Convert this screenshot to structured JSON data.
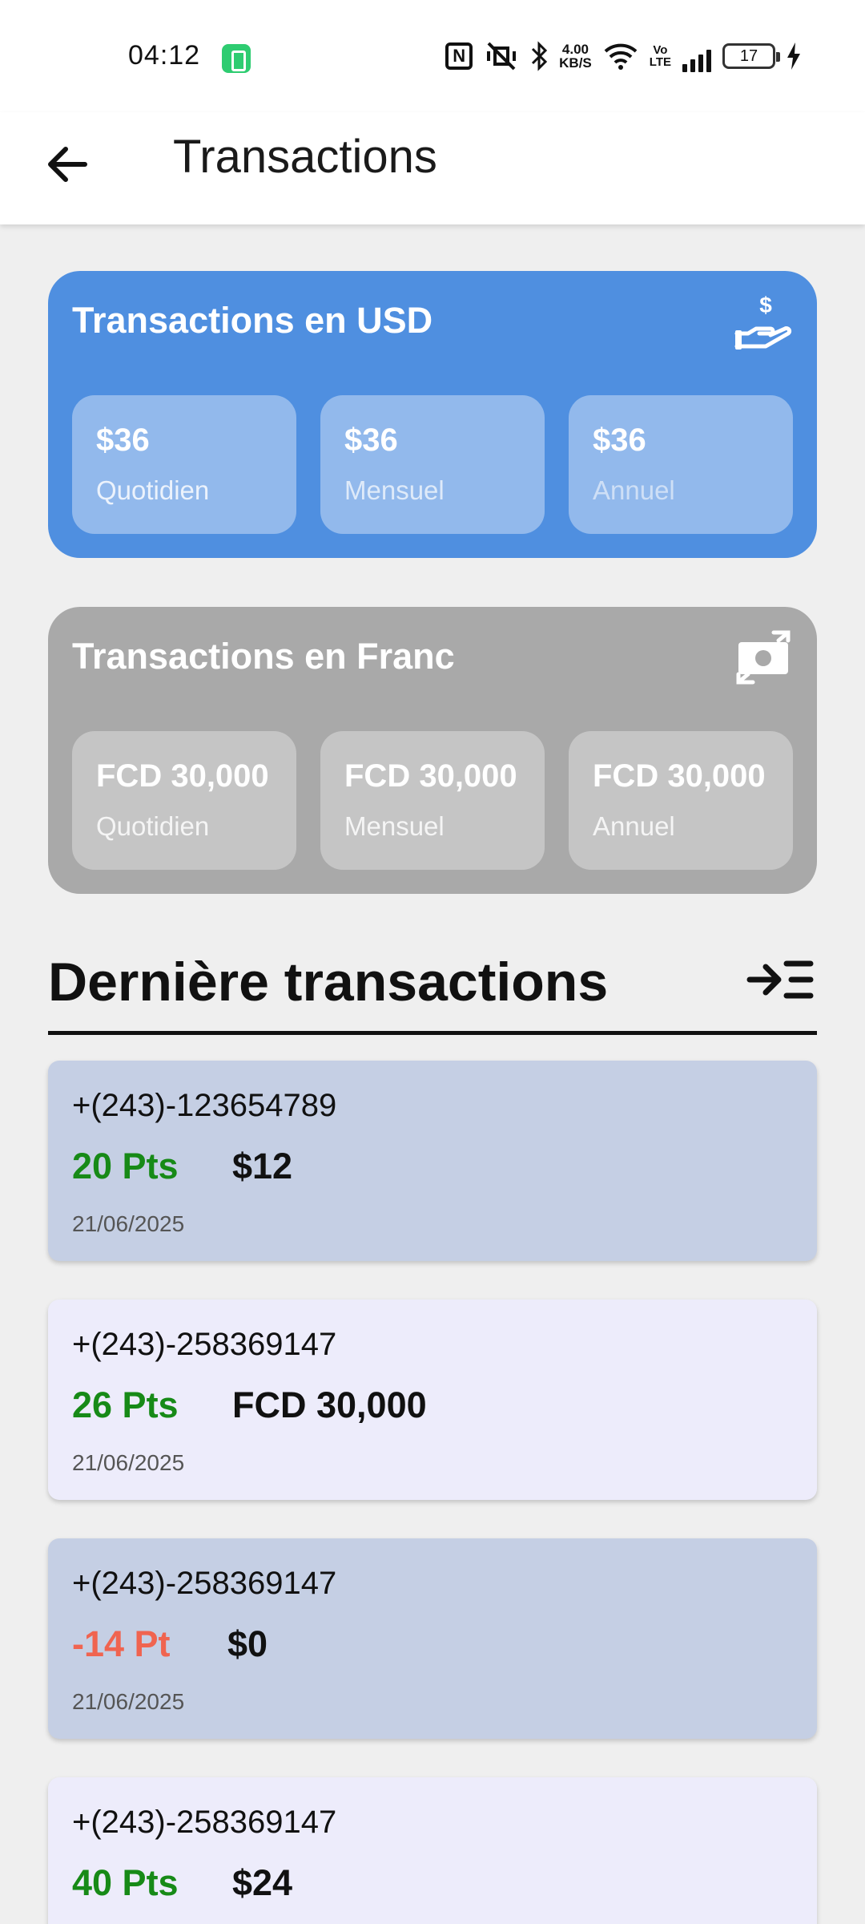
{
  "status_bar": {
    "time": "04:12",
    "net_speed_value": "4.00",
    "net_speed_unit": "KB/S",
    "lte_top": "Vo",
    "lte_bottom": "LTE",
    "battery_level": "17"
  },
  "app_bar": {
    "title": "Transactions",
    "back_icon": "arrow-left-icon"
  },
  "usd_card": {
    "title": "Transactions en USD",
    "icon": "hand-dollar-icon",
    "color": "#4f8fe0",
    "stats": [
      {
        "value": "$36",
        "label": "Quotidien"
      },
      {
        "value": "$36",
        "label": "Mensuel"
      },
      {
        "value": "$36",
        "label": "Annuel"
      }
    ]
  },
  "franc_card": {
    "title": "Transactions en Franc",
    "icon": "money-exchange-icon",
    "color": "#a9a9a9",
    "stats": [
      {
        "value": "FCD 30,000",
        "label": "Quotidien"
      },
      {
        "value": "FCD 30,000",
        "label": "Mensuel"
      },
      {
        "value": "FCD 30,000",
        "label": "Annuel"
      }
    ]
  },
  "recent": {
    "title": "Dernière transactions",
    "filter_icon": "arrow-list-icon",
    "items": [
      {
        "phone": "+(243)-123654789",
        "points": "20 Pts",
        "amount": "$12",
        "date": "21/06/2025"
      },
      {
        "phone": "+(243)-258369147",
        "points": "26 Pts",
        "amount": "FCD 30,000",
        "date": "21/06/2025"
      },
      {
        "phone": "+(243)-258369147",
        "points": "-14 Pt",
        "amount": "$0",
        "date": "21/06/2025"
      },
      {
        "phone": "+(243)-258369147",
        "points": "40 Pts",
        "amount": "$24",
        "date": ""
      }
    ]
  },
  "colors": {
    "positive": "#178a17",
    "negative": "#f06450",
    "row_a": "#c5cfe4",
    "row_b": "#edecfb"
  }
}
